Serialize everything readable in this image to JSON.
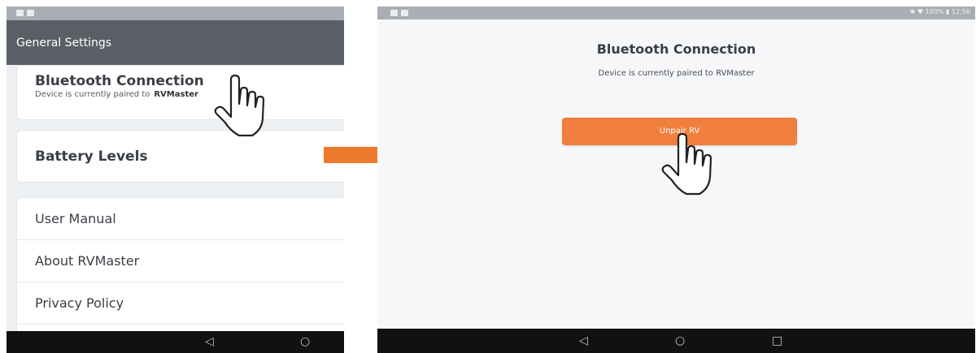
{
  "left": {
    "status_bar": {
      "icons": [
        "gallery-icon",
        "image-icon"
      ]
    },
    "header": {
      "title": "General Settings"
    },
    "bluetooth_card": {
      "title": "Bluetooth Connection",
      "subtitle": "Device is currently paired to",
      "device": "RVMaster"
    },
    "battery_card": {
      "title": "Battery Levels"
    },
    "menu_items": [
      {
        "label": "User Manual"
      },
      {
        "label": "About RVMaster"
      },
      {
        "label": "Privacy Policy"
      }
    ],
    "nav": {
      "back_icon": "◁",
      "home_icon": "○"
    }
  },
  "arrow": {
    "color": "#ed7a2b"
  },
  "right": {
    "status_bar": {
      "status_text": "✱ ♥ 100% ▮ 12:56"
    },
    "title": "Bluetooth Connection",
    "subtitle": "Device is currently paired to RVMaster",
    "unpair_button": {
      "label": "Unpair RV",
      "color": "#f07f3e"
    },
    "nav": {
      "back_icon": "◁",
      "home_icon": "○",
      "recents_icon": "□"
    }
  }
}
